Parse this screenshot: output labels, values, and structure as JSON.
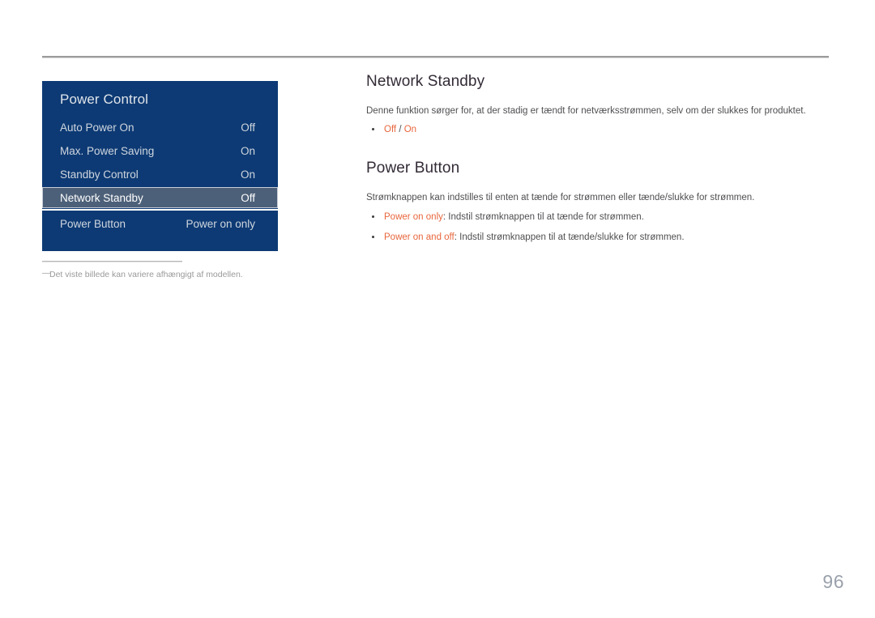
{
  "page": {
    "number": "96",
    "background": "#ffffff",
    "accent_orange": "#e8663c",
    "menu_navy": "#0d3a74",
    "menu_highlight": "#4d6079"
  },
  "osd_menu": {
    "title": "Power Control",
    "rows": [
      {
        "label": "Auto Power On",
        "value": "Off",
        "selected": false
      },
      {
        "label": "Max. Power Saving",
        "value": "On",
        "selected": false
      },
      {
        "label": "Standby Control",
        "value": "On",
        "selected": false
      },
      {
        "label": "Network Standby",
        "value": "Off",
        "selected": true
      },
      {
        "label": "Power Button",
        "value": "Power on only",
        "selected": false
      }
    ]
  },
  "footnote": {
    "marker": "―",
    "text": "Det viste billede kan variere afhængigt af modellen."
  },
  "sections": [
    {
      "heading": "Network Standby",
      "body": "Denne funktion sørger for, at der stadig er tændt for netværksstrømmen, selv om der slukkes for produktet.",
      "bullets": [
        {
          "term": "Off",
          "separator": " / ",
          "term2": "On",
          "description": ""
        }
      ]
    },
    {
      "heading": "Power Button",
      "body": "Strømknappen kan indstilles til enten at tænde for strømmen eller tænde/slukke for strømmen.",
      "bullets": [
        {
          "term": "Power on only",
          "description": ": Indstil strømknappen til at tænde for strømmen."
        },
        {
          "term": "Power on and off",
          "description": ": Indstil strømknappen til at tænde/slukke for strømmen."
        }
      ]
    }
  ]
}
